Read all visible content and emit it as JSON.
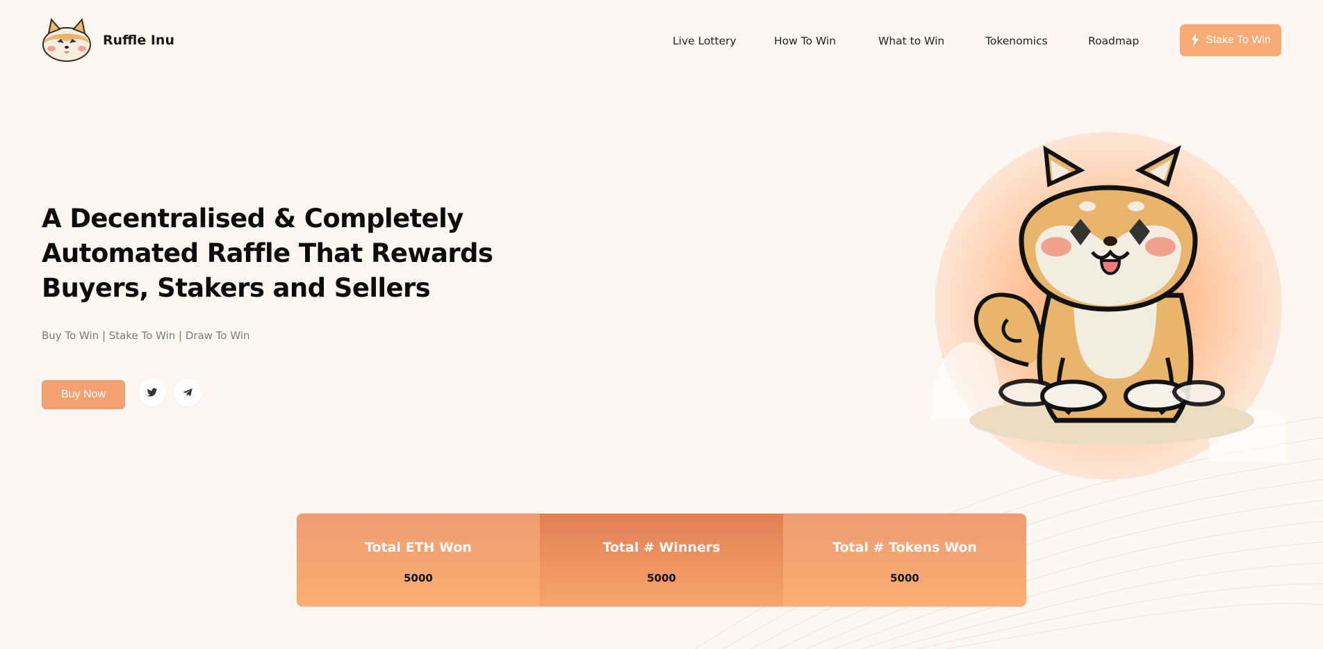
{
  "brand": {
    "name": "Ruffle Inu"
  },
  "nav": {
    "items": [
      {
        "label": "Live Lottery"
      },
      {
        "label": "How To Win"
      },
      {
        "label": "What to Win"
      },
      {
        "label": "Tokenomics"
      },
      {
        "label": "Roadmap"
      }
    ],
    "cta_label": "Stake To Win"
  },
  "hero": {
    "title_line1": "A Decentralised & Completely",
    "title_line2": "Automated Raffle That Rewards",
    "title_line3": "Buyers, Stakers and Sellers",
    "subtitle": "Buy To Win | Stake To Win | Draw To Win",
    "buy_label": "Buy Now",
    "social": [
      "twitter-icon",
      "telegram-icon"
    ]
  },
  "stats": [
    {
      "label": "Total ETH Won",
      "value": "5000"
    },
    {
      "label": "Total # Winners",
      "value": "5000"
    },
    {
      "label": "Total # Tokens Won",
      "value": "5000"
    }
  ],
  "colors": {
    "background": "#fdf7f1",
    "accent": "#f4a171",
    "accent_dark": "#e17f55"
  }
}
